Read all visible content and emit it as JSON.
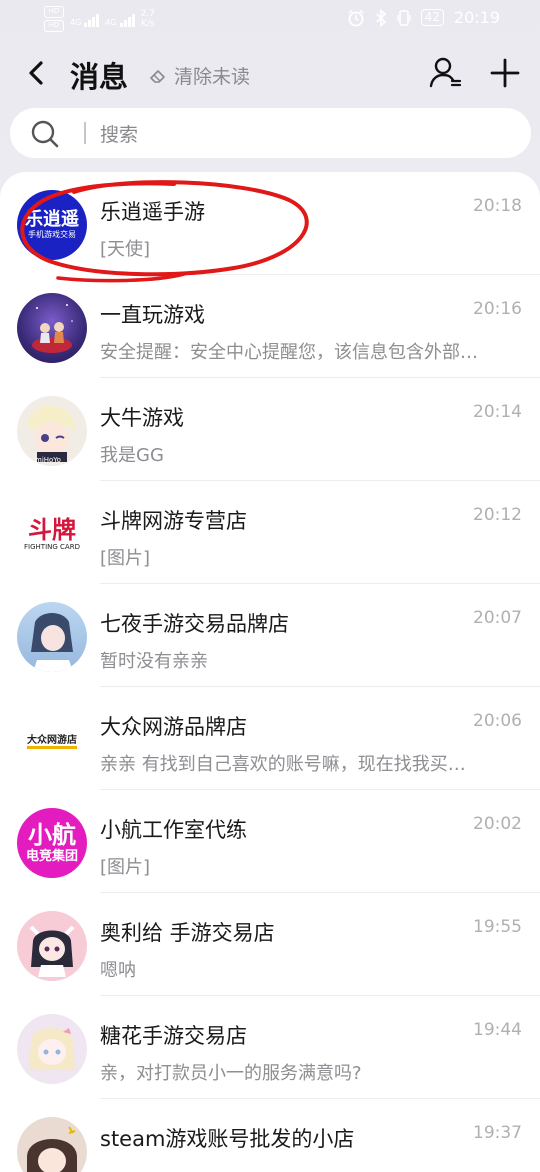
{
  "status_bar": {
    "hd1": "HD",
    "hd2": "HD",
    "net1": "4G",
    "net2": "4G",
    "speed_value": "2.7",
    "speed_unit": "K/s",
    "battery": "42",
    "time": "20:19"
  },
  "header": {
    "title": "消息",
    "clear_label": "清除未读"
  },
  "search": {
    "placeholder": "搜索"
  },
  "messages": [
    {
      "name": "乐逍遥手游",
      "preview": "[天使]",
      "time": "20:18",
      "avatar_text": "乐逍遥",
      "avatar_sub": "手机游戏交易",
      "avatar_bg": "#1a22c4"
    },
    {
      "name": "一直玩游戏",
      "preview": "安全提醒：安全中心提醒您，该信息包含外部…",
      "time": "20:16",
      "avatar_bg": "#5a3fa0"
    },
    {
      "name": "大牛游戏",
      "preview": "我是GG",
      "time": "20:14",
      "avatar_text": "miHoYo",
      "avatar_bg": "#f1ece6"
    },
    {
      "name": "斗牌网游专营店",
      "preview": "[图片]",
      "time": "20:12",
      "avatar_text": "斗牌",
      "avatar_sub": "FIGHTING CARD",
      "avatar_bg": "#ffffff",
      "accent": "#d4163c"
    },
    {
      "name": "七夜手游交易品牌店",
      "preview": "暂时没有亲亲",
      "time": "20:07",
      "avatar_bg": "#a9c7e8"
    },
    {
      "name": "大众网游品牌店",
      "preview": "亲亲  有找到自己喜欢的账号嘛，现在找我买…",
      "time": "20:06",
      "avatar_text": "大众网游店",
      "avatar_bg": "#ffffff"
    },
    {
      "name": "小航工作室代练",
      "preview": "[图片]",
      "time": "20:02",
      "avatar_text": "小航",
      "avatar_sub": "电竞集团",
      "avatar_bg": "#e41cc0"
    },
    {
      "name": "奥利给 手游交易店",
      "preview": "嗯呐",
      "time": "19:55",
      "avatar_bg": "#f4c7d0"
    },
    {
      "name": "糖花手游交易店",
      "preview": "亲，对打款员小一的服务满意吗?",
      "time": "19:44",
      "avatar_bg": "#efe6f2"
    },
    {
      "name": "steam游戏账号批发的小店",
      "preview": "",
      "time": "19:37",
      "avatar_bg": "#5b4640"
    }
  ]
}
